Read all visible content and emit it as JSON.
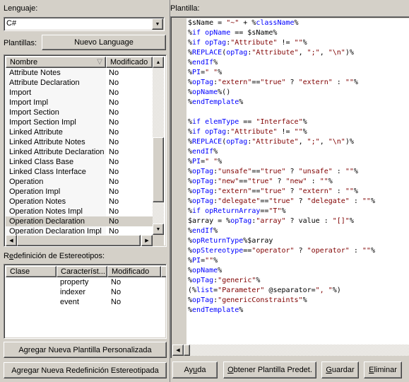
{
  "left": {
    "language_label": "Lenguaje:",
    "language_value": "C#",
    "templates_label": "Plantillas:",
    "new_language_button": "Nuevo Language",
    "templates_table": {
      "columns": [
        "Nombre",
        "Modificado"
      ],
      "sort_indicator": "▽",
      "rows": [
        {
          "name": "Attribute Notes",
          "modified": "No"
        },
        {
          "name": "Attribute Declaration",
          "modified": "No"
        },
        {
          "name": "Import",
          "modified": "No"
        },
        {
          "name": "Import Impl",
          "modified": "No"
        },
        {
          "name": "Import Section",
          "modified": "No"
        },
        {
          "name": "Import Section Impl",
          "modified": "No"
        },
        {
          "name": "Linked Attribute",
          "modified": "No"
        },
        {
          "name": "Linked Attribute Notes",
          "modified": "No"
        },
        {
          "name": "Linked Attribute Declaration",
          "modified": "No"
        },
        {
          "name": "Linked Class Base",
          "modified": "No"
        },
        {
          "name": "Linked Class Interface",
          "modified": "No"
        },
        {
          "name": "Operation",
          "modified": "No"
        },
        {
          "name": "Operation Impl",
          "modified": "No"
        },
        {
          "name": "Operation Notes",
          "modified": "No"
        },
        {
          "name": "Operation Notes Impl",
          "modified": "No"
        },
        {
          "name": "Operation Declaration",
          "modified": "No",
          "selected": true
        },
        {
          "name": "Operation Declaration Impl",
          "modified": "No"
        }
      ]
    },
    "stereotype_label_prefix": "R",
    "stereotype_label_underlined": "e",
    "stereotype_label_rest": "definición de Estereotipos:",
    "stereotype_table": {
      "columns": [
        "Clase",
        "Característ...",
        "Modificado"
      ],
      "rows": [
        {
          "class": "",
          "feature": "property",
          "modified": "No"
        },
        {
          "class": "",
          "feature": "indexer",
          "modified": "No"
        },
        {
          "class": "",
          "feature": "event",
          "modified": "No"
        }
      ]
    },
    "add_custom_template_button": "Agregar Nueva Plantilla Personalizada",
    "add_stereotype_override_button": "Agregar Nueva Redefinición Estereotipada"
  },
  "right": {
    "template_label": "Plantilla:",
    "code_lines": [
      [
        [
          "pc",
          "$sName = "
        ],
        [
          "str",
          "\"~\""
        ],
        [
          "pc",
          " + "
        ],
        [
          "pc",
          "%"
        ],
        [
          "kw",
          "className"
        ],
        [
          "pc",
          "%"
        ]
      ],
      [
        [
          "pc",
          "%"
        ],
        [
          "kw",
          "if opName"
        ],
        [
          "pc",
          " == $sName%"
        ]
      ],
      [
        [
          "pc",
          "%"
        ],
        [
          "kw",
          "if opTag"
        ],
        [
          "pc",
          ":"
        ],
        [
          "str",
          "\"Attribute\""
        ],
        [
          "pc",
          " != "
        ],
        [
          "str",
          "\"\""
        ],
        [
          "pc",
          "%"
        ]
      ],
      [
        [
          "pc",
          "%"
        ],
        [
          "kw",
          "REPLACE"
        ],
        [
          "pc",
          "("
        ],
        [
          "kw",
          "opTag"
        ],
        [
          "pc",
          ":"
        ],
        [
          "str",
          "\"Attribute\""
        ],
        [
          "pc",
          ", "
        ],
        [
          "str",
          "\";\""
        ],
        [
          "pc",
          ", "
        ],
        [
          "str",
          "\"\\n\""
        ],
        [
          "pc",
          ")%"
        ]
      ],
      [
        [
          "pc",
          "%"
        ],
        [
          "kw",
          "endIf"
        ],
        [
          "pc",
          "%"
        ]
      ],
      [
        [
          "pc",
          "%"
        ],
        [
          "kw",
          "PI"
        ],
        [
          "pc",
          "="
        ],
        [
          "str",
          "\" \""
        ],
        [
          "pc",
          "%"
        ]
      ],
      [
        [
          "pc",
          "%"
        ],
        [
          "kw",
          "opTag"
        ],
        [
          "pc",
          ":"
        ],
        [
          "str",
          "\"extern\""
        ],
        [
          "pc",
          "=="
        ],
        [
          "str",
          "\"true\""
        ],
        [
          "pc",
          " ? "
        ],
        [
          "str",
          "\"extern\""
        ],
        [
          "pc",
          " : "
        ],
        [
          "str",
          "\"\""
        ],
        [
          "pc",
          "%"
        ]
      ],
      [
        [
          "pc",
          "%"
        ],
        [
          "kw",
          "opName"
        ],
        [
          "pc",
          "%()"
        ]
      ],
      [
        [
          "pc",
          "%"
        ],
        [
          "kw",
          "endTemplate"
        ],
        [
          "pc",
          "%"
        ]
      ],
      [],
      [
        [
          "pc",
          "%"
        ],
        [
          "kw",
          "if elemType"
        ],
        [
          "pc",
          " == "
        ],
        [
          "str",
          "\"Interface\""
        ],
        [
          "pc",
          "%"
        ]
      ],
      [
        [
          "pc",
          "%"
        ],
        [
          "kw",
          "if opTag"
        ],
        [
          "pc",
          ":"
        ],
        [
          "str",
          "\"Attribute\""
        ],
        [
          "pc",
          " != "
        ],
        [
          "str",
          "\"\""
        ],
        [
          "pc",
          "%"
        ]
      ],
      [
        [
          "pc",
          "%"
        ],
        [
          "kw",
          "REPLACE"
        ],
        [
          "pc",
          "("
        ],
        [
          "kw",
          "opTag"
        ],
        [
          "pc",
          ":"
        ],
        [
          "str",
          "\"Attribute\""
        ],
        [
          "pc",
          ", "
        ],
        [
          "str",
          "\";\""
        ],
        [
          "pc",
          ", "
        ],
        [
          "str",
          "\"\\n\""
        ],
        [
          "pc",
          ")%"
        ]
      ],
      [
        [
          "pc",
          "%"
        ],
        [
          "kw",
          "endIf"
        ],
        [
          "pc",
          "%"
        ]
      ],
      [
        [
          "pc",
          "%"
        ],
        [
          "kw",
          "PI"
        ],
        [
          "pc",
          "="
        ],
        [
          "str",
          "\" \""
        ],
        [
          "pc",
          "%"
        ]
      ],
      [
        [
          "pc",
          "%"
        ],
        [
          "kw",
          "opTag"
        ],
        [
          "pc",
          ":"
        ],
        [
          "str",
          "\"unsafe\""
        ],
        [
          "pc",
          "=="
        ],
        [
          "str",
          "\"true\""
        ],
        [
          "pc",
          " ? "
        ],
        [
          "str",
          "\"unsafe\""
        ],
        [
          "pc",
          " : "
        ],
        [
          "str",
          "\"\""
        ],
        [
          "pc",
          "%"
        ]
      ],
      [
        [
          "pc",
          "%"
        ],
        [
          "kw",
          "opTag"
        ],
        [
          "pc",
          ":"
        ],
        [
          "str",
          "\"new\""
        ],
        [
          "pc",
          "=="
        ],
        [
          "str",
          "\"true\""
        ],
        [
          "pc",
          " ? "
        ],
        [
          "str",
          "\"new\""
        ],
        [
          "pc",
          " : "
        ],
        [
          "str",
          "\"\""
        ],
        [
          "pc",
          "%"
        ]
      ],
      [
        [
          "pc",
          "%"
        ],
        [
          "kw",
          "opTag"
        ],
        [
          "pc",
          ":"
        ],
        [
          "str",
          "\"extern\""
        ],
        [
          "pc",
          "=="
        ],
        [
          "str",
          "\"true\""
        ],
        [
          "pc",
          " ? "
        ],
        [
          "str",
          "\"extern\""
        ],
        [
          "pc",
          " : "
        ],
        [
          "str",
          "\"\""
        ],
        [
          "pc",
          "%"
        ]
      ],
      [
        [
          "pc",
          "%"
        ],
        [
          "kw",
          "opTag"
        ],
        [
          "pc",
          ":"
        ],
        [
          "str",
          "\"delegate\""
        ],
        [
          "pc",
          "=="
        ],
        [
          "str",
          "\"true\""
        ],
        [
          "pc",
          " ? "
        ],
        [
          "str",
          "\"delegate\""
        ],
        [
          "pc",
          " : "
        ],
        [
          "str",
          "\"\""
        ],
        [
          "pc",
          "%"
        ]
      ],
      [
        [
          "pc",
          "%"
        ],
        [
          "kw",
          "if opReturnArray"
        ],
        [
          "pc",
          "=="
        ],
        [
          "str",
          "\"T\""
        ],
        [
          "pc",
          "%"
        ]
      ],
      [
        [
          "pc",
          "$array = %"
        ],
        [
          "kw",
          "opTag"
        ],
        [
          "pc",
          ":"
        ],
        [
          "str",
          "\"array\""
        ],
        [
          "pc",
          " ? value : "
        ],
        [
          "str",
          "\"[]\""
        ],
        [
          "pc",
          "%"
        ]
      ],
      [
        [
          "pc",
          "%"
        ],
        [
          "kw",
          "endIf"
        ],
        [
          "pc",
          "%"
        ]
      ],
      [
        [
          "pc",
          "%"
        ],
        [
          "kw",
          "opReturnType"
        ],
        [
          "pc",
          "%$array"
        ]
      ],
      [
        [
          "pc",
          "%"
        ],
        [
          "kw",
          "opStereotype"
        ],
        [
          "pc",
          "=="
        ],
        [
          "str",
          "\"operator\""
        ],
        [
          "pc",
          " ? "
        ],
        [
          "str",
          "\"operator\""
        ],
        [
          "pc",
          " : "
        ],
        [
          "str",
          "\"\""
        ],
        [
          "pc",
          "%"
        ]
      ],
      [
        [
          "pc",
          "%"
        ],
        [
          "kw",
          "PI"
        ],
        [
          "pc",
          "="
        ],
        [
          "str",
          "\"\""
        ],
        [
          "pc",
          "%"
        ]
      ],
      [
        [
          "pc",
          "%"
        ],
        [
          "kw",
          "opName"
        ],
        [
          "pc",
          "%"
        ]
      ],
      [
        [
          "pc",
          "%"
        ],
        [
          "kw",
          "opTag"
        ],
        [
          "pc",
          ":"
        ],
        [
          "str",
          "\"generic\""
        ],
        [
          "pc",
          "%"
        ]
      ],
      [
        [
          "pc",
          "(%"
        ],
        [
          "kw",
          "list"
        ],
        [
          "pc",
          "="
        ],
        [
          "str",
          "\"Parameter\""
        ],
        [
          "pc",
          " @separator="
        ],
        [
          "str",
          "\", \""
        ],
        [
          "pc",
          "%)"
        ]
      ],
      [
        [
          "pc",
          "%"
        ],
        [
          "kw",
          "opTag"
        ],
        [
          "pc",
          ":"
        ],
        [
          "str",
          "\"genericConstraints\""
        ],
        [
          "pc",
          "%"
        ]
      ],
      [
        [
          "pc",
          "%"
        ],
        [
          "kw",
          "endTemplate"
        ],
        [
          "pc",
          "%"
        ]
      ]
    ],
    "help_button": {
      "prefix": "Ay",
      "underlined": "u",
      "rest": "da"
    },
    "get_default_button": {
      "prefix": "",
      "underlined": "O",
      "rest": "btener Plantilla Predet."
    },
    "save_button": {
      "prefix": "",
      "underlined": "G",
      "rest": "uardar"
    },
    "delete_button": {
      "prefix": "",
      "underlined": "E",
      "rest": "liminar"
    }
  },
  "colors": {
    "keyword": "#0000ff",
    "string": "#800000",
    "window_bg": "#d4d0c8"
  },
  "icons": {
    "dropdown": "▼",
    "scroll_up": "▲",
    "scroll_down": "▼",
    "scroll_left": "◀",
    "scroll_right": "▶"
  }
}
